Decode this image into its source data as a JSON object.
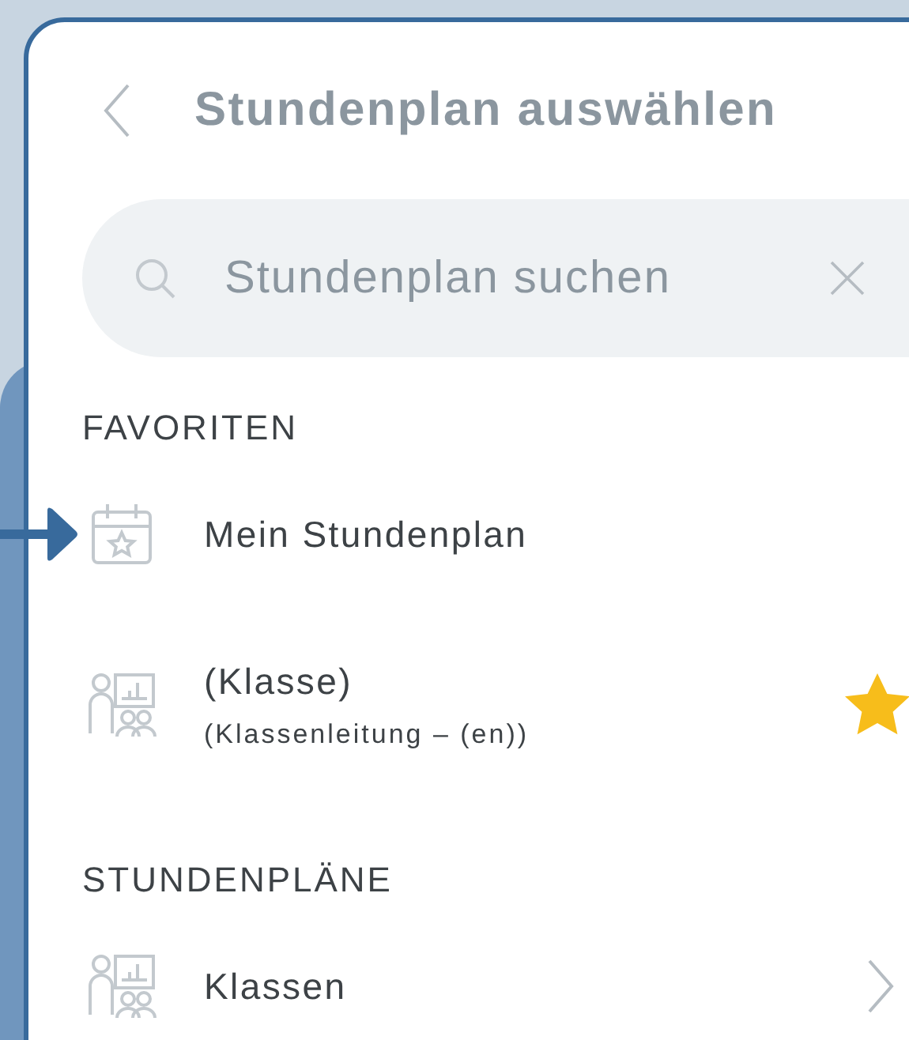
{
  "header": {
    "title": "Stundenplan auswählen"
  },
  "search": {
    "placeholder": "Stundenplan suchen"
  },
  "sections": [
    {
      "title": "FAVORITEN",
      "items": [
        {
          "kind": "calendar",
          "title": "Mein Stundenplan",
          "highlighted": true,
          "favorite": false,
          "has_children": false
        },
        {
          "kind": "class",
          "title": "(Klasse)",
          "subtitle": "(Klassenleitung – (en))",
          "highlighted": false,
          "favorite": true,
          "has_children": false
        }
      ]
    },
    {
      "title": "STUNDENPLÄNE",
      "items": [
        {
          "kind": "class",
          "title": "Klassen",
          "highlighted": false,
          "favorite": false,
          "has_children": true
        }
      ]
    }
  ]
}
